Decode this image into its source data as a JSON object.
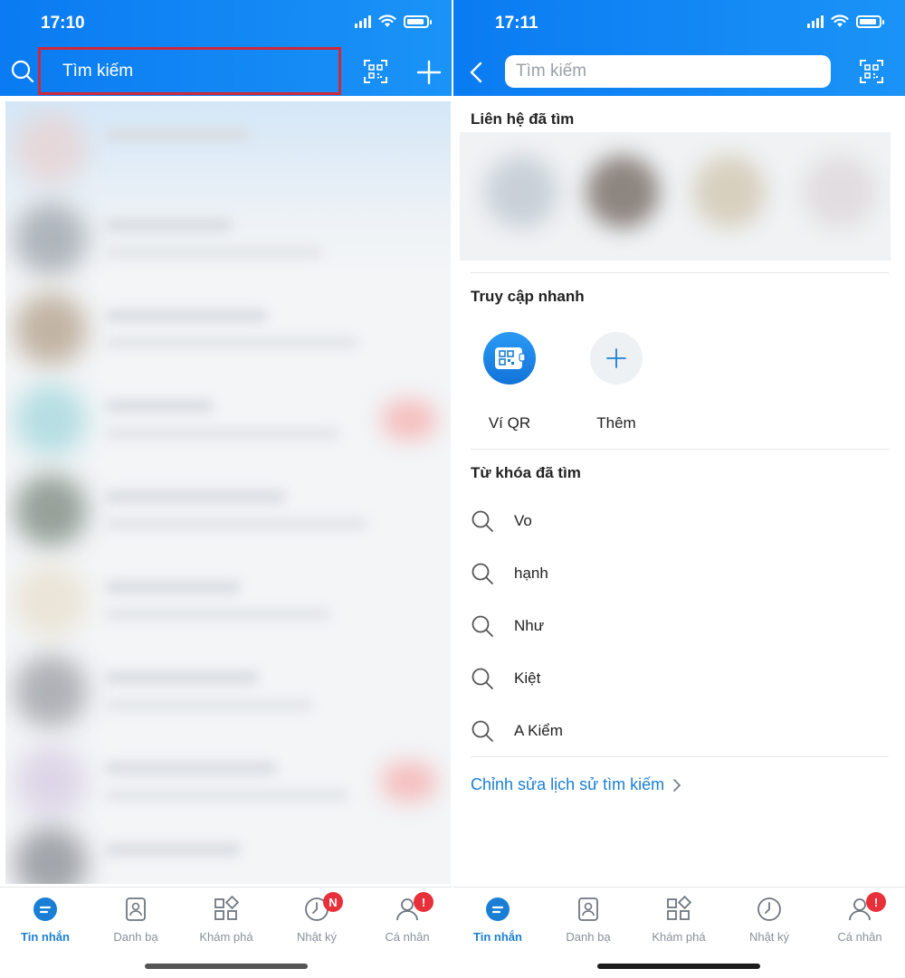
{
  "left": {
    "status_time": "17:10",
    "search_placeholder": "Tìm kiếm"
  },
  "right": {
    "status_time": "17:11",
    "search_placeholder": "Tìm kiếm",
    "recent_contacts_title": "Liên hệ đã tìm",
    "quick_access_title": "Truy cập nhanh",
    "quick_access": [
      {
        "label": "Ví QR",
        "icon": "qr-wallet-icon"
      },
      {
        "label": "Thêm",
        "icon": "plus-icon"
      }
    ],
    "keywords_title": "Từ khóa đã tìm",
    "keywords": [
      "Vo",
      "hạnh",
      "Như",
      "Kiệt",
      "A Kiểm"
    ],
    "edit_history_label": "Chỉnh sửa lịch sử tìm kiếm"
  },
  "bottom_nav": {
    "items": [
      {
        "label": "Tin nhắn",
        "icon": "chat-icon",
        "active": true
      },
      {
        "label": "Danh bạ",
        "icon": "contacts-icon"
      },
      {
        "label": "Khám phá",
        "icon": "explore-icon"
      },
      {
        "label": "Nhật ký",
        "icon": "clock-icon"
      },
      {
        "label": "Cá nhân",
        "icon": "user-icon"
      }
    ],
    "left_badges": {
      "nhat_ky": "N",
      "ca_nhan": "!"
    },
    "right_badges": {
      "ca_nhan": "!"
    }
  },
  "colors": {
    "header_blue": "#0a7bf2",
    "accent_blue": "#1a7fd4",
    "highlight_red": "#d0283a",
    "badge_red": "#e8303a"
  }
}
